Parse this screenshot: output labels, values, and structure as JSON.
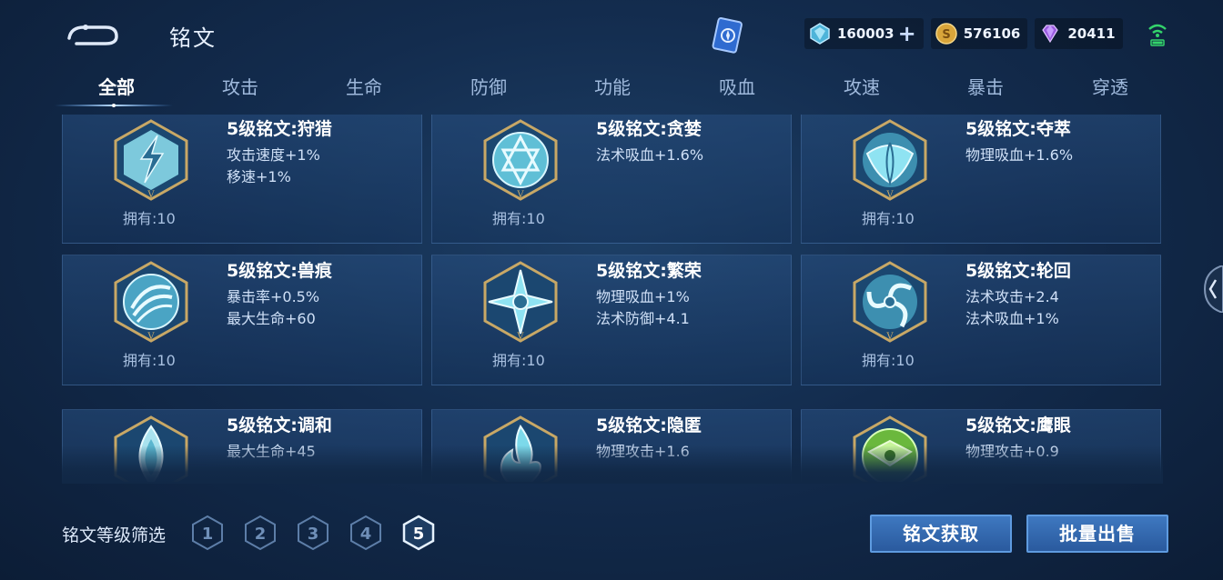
{
  "header": {
    "title": "铭文",
    "resources": [
      {
        "icon": "crystal-icon",
        "value": "160003",
        "has_plus": true
      },
      {
        "icon": "gold-coin-icon",
        "value": "576106",
        "has_plus": false
      },
      {
        "icon": "diamond-icon",
        "value": "20411",
        "has_plus": false
      }
    ]
  },
  "tabs": [
    "全部",
    "攻击",
    "生命",
    "防御",
    "功能",
    "吸血",
    "攻速",
    "暴击",
    "穿透"
  ],
  "active_tab": 0,
  "cards": [
    {
      "name": "5级铭文:狩猎",
      "stat1": "攻击速度+1%",
      "stat2": "移速+1%",
      "owned": "拥有:10",
      "emblem": "lightning-emblem-icon",
      "color": "#6cd6e8"
    },
    {
      "name": "5级铭文:贪婪",
      "stat1": "法术吸血+1.6%",
      "stat2": "",
      "owned": "拥有:10",
      "emblem": "star-emblem-icon",
      "color": "#6cd6e8"
    },
    {
      "name": "5级铭文:夺萃",
      "stat1": "物理吸血+1.6%",
      "stat2": "",
      "owned": "拥有:10",
      "emblem": "knot-emblem-icon",
      "color": "#6cd6e8"
    },
    {
      "name": "5级铭文:兽痕",
      "stat1": "暴击率+0.5%",
      "stat2": "最大生命+60",
      "owned": "拥有:10",
      "emblem": "claw-emblem-icon",
      "color": "#6cd6e8"
    },
    {
      "name": "5级铭文:繁荣",
      "stat1": "物理吸血+1%",
      "stat2": "法术防御+4.1",
      "owned": "拥有:10",
      "emblem": "cross-emblem-icon",
      "color": "#6cd6e8"
    },
    {
      "name": "5级铭文:轮回",
      "stat1": "法术攻击+2.4",
      "stat2": "法术吸血+1%",
      "owned": "拥有:10",
      "emblem": "swirl-emblem-icon",
      "color": "#6cd6e8"
    },
    {
      "name": "5级铭文:调和",
      "stat1": "最大生命+45",
      "stat2": "",
      "owned": "",
      "emblem": "drop-emblem-icon",
      "color": "#a9e2ee"
    },
    {
      "name": "5级铭文:隐匿",
      "stat1": "物理攻击+1.6",
      "stat2": "",
      "owned": "",
      "emblem": "flame-emblem-icon",
      "color": "#7cd9ea"
    },
    {
      "name": "5级铭文:鹰眼",
      "stat1": "物理攻击+0.9",
      "stat2": "",
      "owned": "",
      "emblem": "eagle-emblem-icon",
      "color": "#8fe06a"
    }
  ],
  "filter": {
    "label": "铭文等级筛选",
    "levels": [
      "1",
      "2",
      "3",
      "4",
      "5"
    ],
    "selected": "5"
  },
  "buttons": {
    "obtain": "铭文获取",
    "bulk_sell": "批量出售"
  },
  "colors": {
    "accent": "#3e78c0",
    "tab_active": "#ffffff",
    "tab_inactive": "#9fb9dc",
    "gold_frame": "#c8a866"
  }
}
